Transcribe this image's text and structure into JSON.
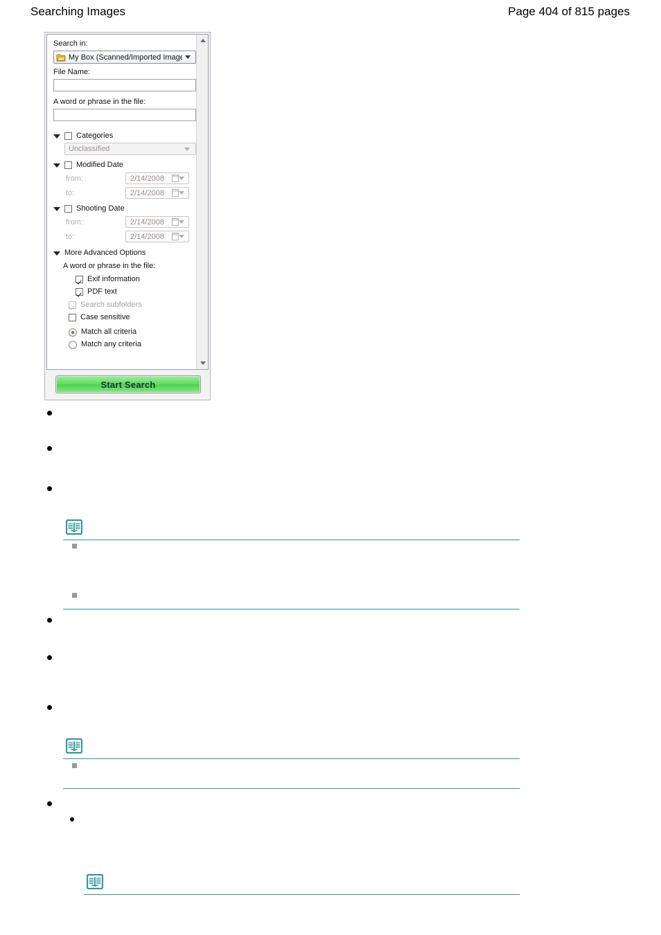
{
  "header": {
    "title": "Searching Images",
    "page_label": "Page 404 of 815 pages"
  },
  "dialog": {
    "search_in": {
      "label": "Search in:",
      "value": "My Box (Scanned/Imported Images)",
      "icon": "folder-icon"
    },
    "file_name": {
      "label": "File Name:",
      "value": "",
      "placeholder": ""
    },
    "word_or_phrase": {
      "label": "A word or phrase in the file:",
      "value": "",
      "placeholder": ""
    },
    "categories": {
      "label": "Categories",
      "checked": false,
      "select_value": "Unclassified",
      "disabled": true
    },
    "modified_date": {
      "label": "Modified Date",
      "checked": false,
      "from_label": "from:",
      "from_value": "2/14/2008",
      "to_label": "to:",
      "to_value": "2/14/2008"
    },
    "shooting_date": {
      "label": "Shooting Date",
      "checked": false,
      "from_label": "from:",
      "from_value": "2/14/2008",
      "to_label": "to:",
      "to_value": "2/14/2008"
    },
    "more_advanced": {
      "label": "More Advanced Options",
      "sub_label": "A word or phrase in the file:",
      "options": [
        {
          "label": "Exif information",
          "checked": true,
          "disabled": false
        },
        {
          "label": "PDF text",
          "checked": true,
          "disabled": false
        },
        {
          "label": "Search subfolders",
          "checked": true,
          "disabled": true
        },
        {
          "label": "Case sensitive",
          "checked": false,
          "disabled": false
        }
      ],
      "match_options": [
        {
          "label": "Match all criteria",
          "selected": true
        },
        {
          "label": "Match any criteria",
          "selected": false
        }
      ]
    },
    "start_search_button": "Start Search",
    "accent_green": "#5bd85b",
    "scrollbar": {
      "up_icon": "scroll-up-arrow-icon",
      "down_icon": "scroll-down-arrow-icon"
    }
  },
  "content": {
    "note_icon_name": "open-book-icon",
    "rule_color": "#2f9699",
    "bullets": [
      {
        "level": 1,
        "text": ""
      },
      {
        "level": 1,
        "text": ""
      },
      {
        "level": 1,
        "text": ""
      },
      {
        "level": 1,
        "text": ""
      },
      {
        "level": 1,
        "text": ""
      },
      {
        "level": 1,
        "text": ""
      },
      {
        "level": 1,
        "text": ""
      },
      {
        "level": 2,
        "text": ""
      }
    ],
    "sub_bullets": [
      {
        "text": ""
      },
      {
        "text": ""
      },
      {
        "text": ""
      }
    ]
  }
}
